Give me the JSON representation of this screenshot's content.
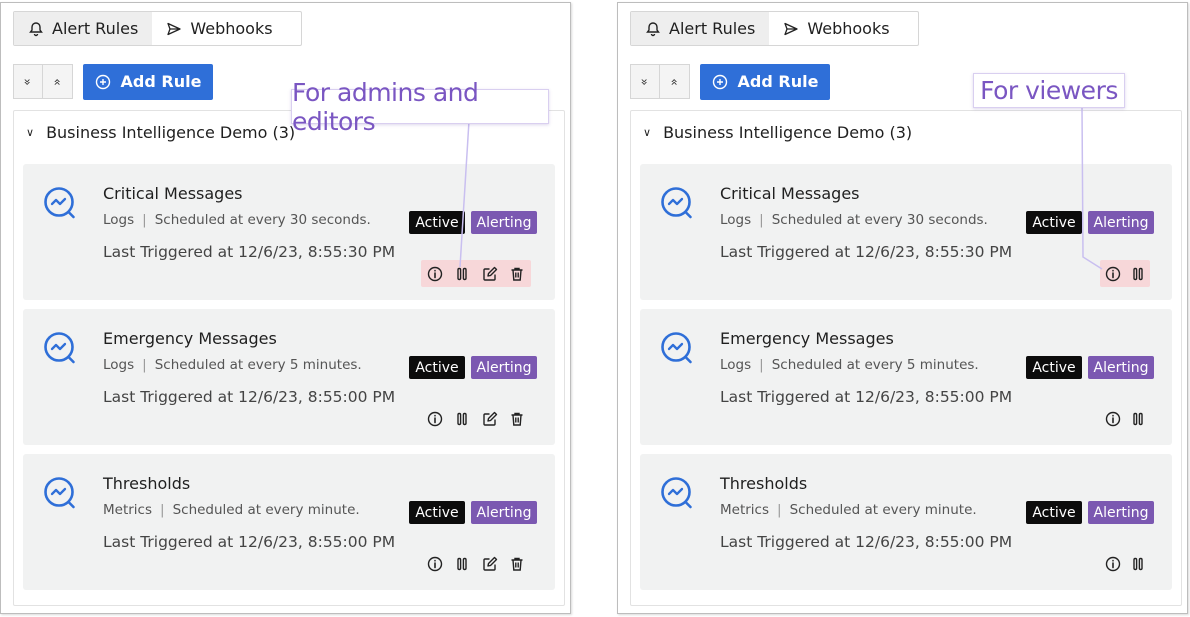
{
  "tabs": [
    {
      "label": "Alert Rules",
      "icon": "bell-icon",
      "active": true
    },
    {
      "label": "Webhooks",
      "icon": "send-icon",
      "active": false
    }
  ],
  "toolbar": {
    "expand_all": "»",
    "collapse_all": "«",
    "add_rule_label": "Add Rule"
  },
  "group": {
    "name": "Business Intelligence Demo (3)"
  },
  "rules": [
    {
      "title": "Critical Messages",
      "source": "Logs",
      "schedule": "Scheduled at every 30 seconds.",
      "last_triggered": "Last Triggered at 12/6/23, 8:55:30 PM",
      "status": "Active",
      "state": "Alerting"
    },
    {
      "title": "Emergency Messages",
      "source": "Logs",
      "schedule": "Scheduled at every 5 minutes.",
      "last_triggered": "Last Triggered at 12/6/23, 8:55:00 PM",
      "status": "Active",
      "state": "Alerting"
    },
    {
      "title": "Thresholds",
      "source": "Metrics",
      "schedule": "Scheduled at every minute.",
      "last_triggered": "Last Triggered at 12/6/23, 8:55:00 PM",
      "status": "Active",
      "state": "Alerting"
    }
  ],
  "callouts": {
    "admins": "For admins and editors",
    "viewers": "For viewers"
  },
  "colors": {
    "accent": "#2f6fd8",
    "alerting": "#7b58b1",
    "active": "#0c0c0c",
    "callout_text": "#7a56c2",
    "highlight": "#f7d7d9"
  }
}
